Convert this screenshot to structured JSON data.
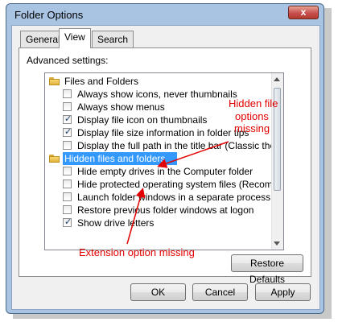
{
  "window": {
    "title": "Folder Options",
    "close_glyph": "x"
  },
  "tabs": [
    {
      "label": "General",
      "active": false
    },
    {
      "label": "View",
      "active": true
    },
    {
      "label": "Search",
      "active": false
    }
  ],
  "advanced": {
    "heading": "Advanced settings:",
    "group_folders": "Files and Folders",
    "group_hidden": "Hidden files and folders",
    "items": [
      {
        "label": "Always show icons, never thumbnails",
        "checked": false
      },
      {
        "label": "Always show menus",
        "checked": false
      },
      {
        "label": "Display file icon on thumbnails",
        "checked": true
      },
      {
        "label": "Display file size information in folder tips",
        "checked": true
      },
      {
        "label": "Display the full path in the title bar (Classic theme only)",
        "checked": false
      },
      {
        "label": "Hide empty drives in the Computer folder",
        "checked": false
      },
      {
        "label": "Hide protected operating system files (Recommended)",
        "checked": false
      },
      {
        "label": "Launch folder windows in a separate process",
        "checked": false
      },
      {
        "label": "Restore previous folder windows at logon",
        "checked": false
      },
      {
        "label": "Show drive letters",
        "checked": true
      }
    ]
  },
  "buttons": {
    "restore_defaults": "Restore Defaults",
    "ok": "OK",
    "cancel": "Cancel",
    "apply": "Apply"
  },
  "annotations": {
    "hidden_line1": "Hidden file",
    "hidden_line2": "options",
    "hidden_line3": "missing",
    "extension": "Extension option missing",
    "color": "#e30000"
  },
  "colors": {
    "selection": "#3399ff",
    "frame": "#a9c4e2"
  }
}
